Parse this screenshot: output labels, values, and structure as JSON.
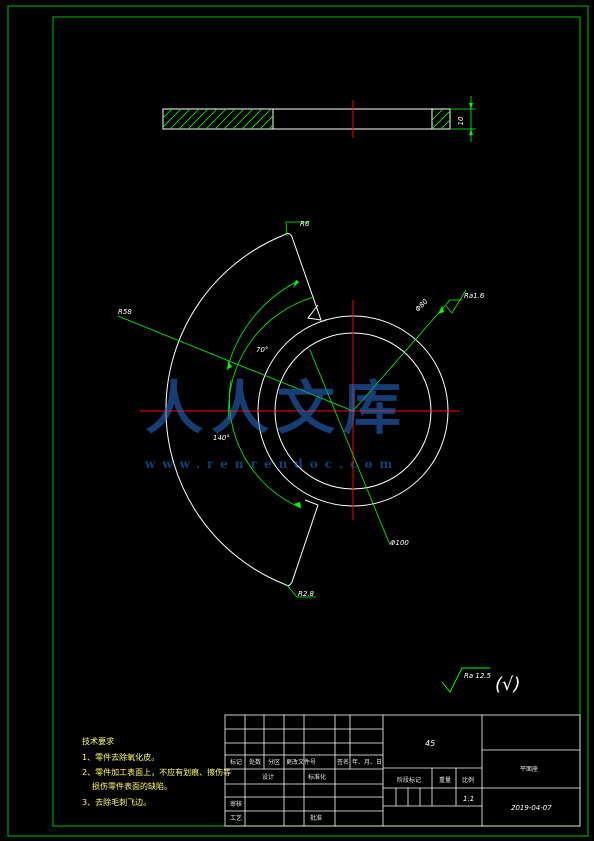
{
  "colors": {
    "frame": "#00c000",
    "outline": "#ffffff",
    "dimension": "#00ff00",
    "center_line": "#ff0000",
    "text": "#ffffff",
    "title_text": "#ffff66",
    "watermark": "#2a6fd0"
  },
  "section_view": {
    "thickness_dim": "10"
  },
  "plan_view": {
    "dims": {
      "r_corner_top": "R6",
      "r_outer": "R58",
      "angle_small": "70°",
      "angle_large": "140°",
      "hole_dia": "Φ80",
      "roughness_hole": "Ra1.6",
      "outer_dia": "Φ100",
      "r_corner_bottom": "R2.8"
    }
  },
  "watermark": {
    "main": "人人文库",
    "url": "www.renrendoc.com"
  },
  "surface_finish": {
    "general": "Ra 12.5",
    "other": "(√)"
  },
  "tech_requirements": {
    "title": "技术要求",
    "items": [
      "1、零件去除氧化皮。",
      "2、零件加工表面上，不应有划痕、擦伤等",
      "损伤零件表面的缺陷。",
      "3、去除毛刺飞边。"
    ]
  },
  "title_block": {
    "material": "45",
    "part_name": "平面座",
    "headers": [
      "标记",
      "处数",
      "分区",
      "更改文件号",
      "签名",
      "年、月、日"
    ],
    "design_row": [
      "设计",
      "标准化"
    ],
    "stage_labels": [
      "阶段标记",
      "重量",
      "比例"
    ],
    "scale": "1:1",
    "review": "审核",
    "process": "工艺",
    "approve": "批准",
    "date": "2019-04-07"
  }
}
